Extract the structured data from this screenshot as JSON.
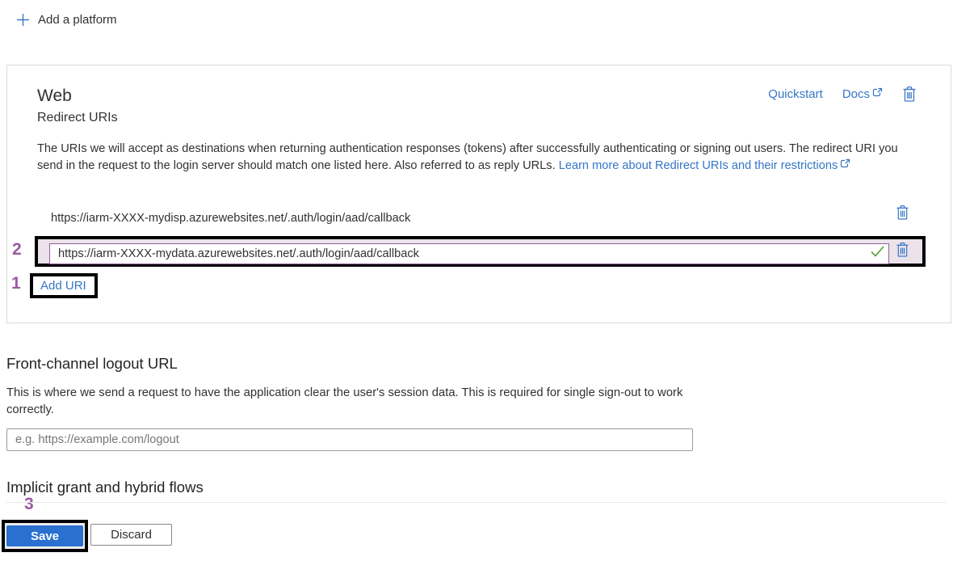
{
  "page": {
    "add_platform_label": "Add a platform"
  },
  "web_card": {
    "title": "Web",
    "subtitle": "Redirect URIs",
    "quickstart_label": "Quickstart",
    "docs_label": "Docs",
    "description": "The URIs we will accept as destinations when returning authentication responses (tokens) after successfully authenticating or signing out users. The redirect URI you send in the request to the login server should match one listed here. Also referred to as reply URLs. ",
    "learn_more_link": "Learn more about Redirect URIs and their restrictions",
    "redirect_uris": [
      {
        "value": "https://iarm-XXXX-mydisp.azurewebsites.net/.auth/login/aad/callback"
      },
      {
        "value": "https://iarm-XXXX-mydata.azurewebsites.net/.auth/login/aad/callback"
      }
    ],
    "add_uri_label": "Add URI"
  },
  "front_channel": {
    "title": "Front-channel logout URL",
    "description": "This is where we send a request to have the application clear the user's session data. This is required for single sign-out to work correctly.",
    "input_value": "",
    "input_placeholder": "e.g. https://example.com/logout"
  },
  "implicit_grant": {
    "title": "Implicit grant and hybrid flows"
  },
  "footer": {
    "save_label": "Save",
    "discard_label": "Discard"
  },
  "annotations": {
    "step1": "1",
    "step2": "2",
    "step3": "3"
  },
  "colors": {
    "link_blue": "#3476c6",
    "icon_blue": "#3b79c9",
    "primary_button": "#2970cf",
    "annotation_purple": "#9c59a0",
    "success_green": "#57a33b",
    "annotation_border": "#000000"
  }
}
